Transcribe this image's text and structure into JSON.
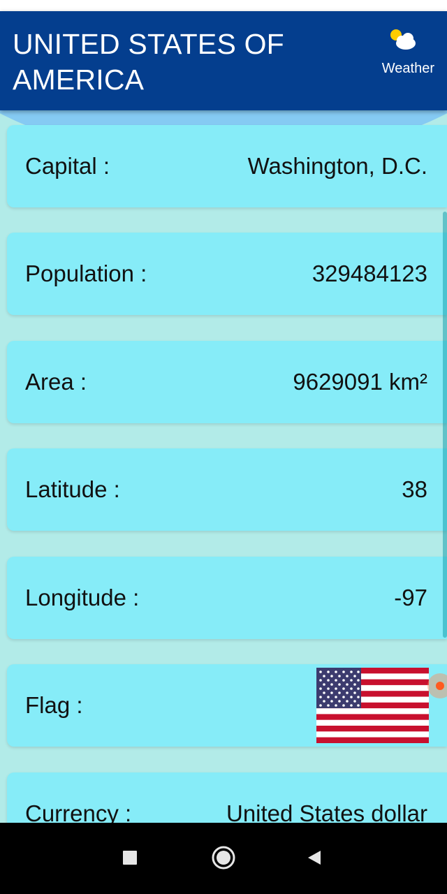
{
  "app_bar": {
    "title": "UNITED STATES OF AMERICA",
    "weather_label": "Weather",
    "weather_icon": "partly-cloudy-icon"
  },
  "rows": [
    {
      "label": "Capital :",
      "value": "Washington, D.C."
    },
    {
      "label": "Population :",
      "value": "329484123"
    },
    {
      "label": "Area :",
      "value": "9629091 km²"
    },
    {
      "label": "Latitude :",
      "value": "38"
    },
    {
      "label": "Longitude :",
      "value": "-97"
    },
    {
      "label": "Flag :",
      "value_icon": "us-flag-icon"
    },
    {
      "label": "Currency :",
      "value": "United States dollar"
    }
  ],
  "nav": {
    "recents_icon": "square-icon",
    "home_icon": "circle-home-icon",
    "back_icon": "triangle-back-icon"
  },
  "colors": {
    "app_bar": "#043e8e",
    "card": "#86ecf8",
    "background": "#b2ebe8"
  }
}
